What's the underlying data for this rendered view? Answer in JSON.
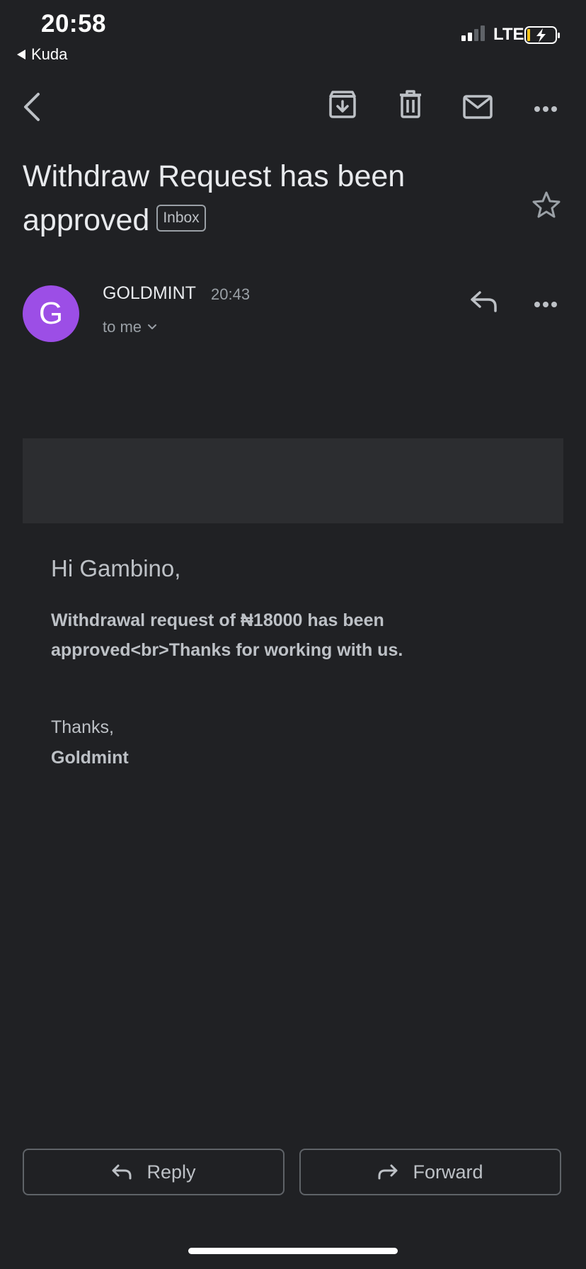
{
  "status_bar": {
    "time": "20:58",
    "back_app": "Kuda",
    "network": "LTE"
  },
  "toolbar": {
    "icons": [
      "back-arrow-icon",
      "archive-icon",
      "trash-icon",
      "mail-icon",
      "more-icon"
    ]
  },
  "email": {
    "subject": "Withdraw Request has been approved",
    "label": "Inbox",
    "sender": "GOLDMINT",
    "avatar_letter": "G",
    "time": "20:43",
    "recipient": "to me",
    "greeting": "Hi Gambino,",
    "body": "Withdrawal request of ₦18000 has been approved<br>Thanks for working with us.",
    "signoff": "Thanks,",
    "signature": "Goldmint"
  },
  "actions": {
    "reply_label": "Reply",
    "forward_label": "Forward"
  },
  "colors": {
    "background": "#202124",
    "avatar": "#9c4ee6",
    "banner": "#2c2d30",
    "battery_charge": "#f5c518"
  }
}
